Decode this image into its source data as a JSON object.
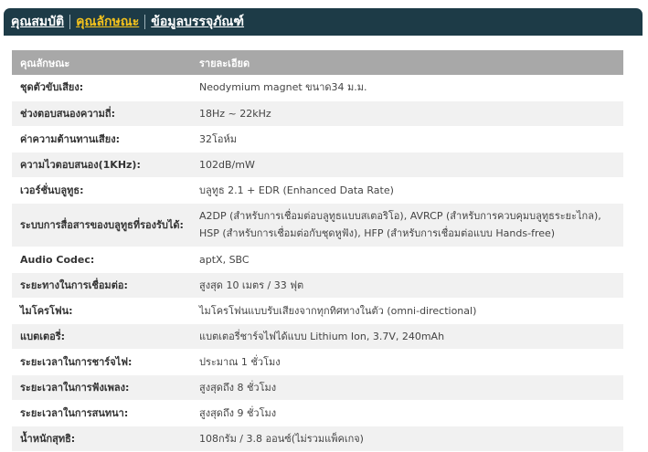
{
  "tabs": [
    {
      "label": "คุณสมบัติ",
      "active": false
    },
    {
      "label": "คุณลักษณะ",
      "active": true
    },
    {
      "label": "ข้อมูลบรรจุภัณฑ์",
      "active": false
    }
  ],
  "spec_table": {
    "headers": [
      "คุณลักษณะ",
      "รายละเอียด"
    ],
    "rows": [
      {
        "key": "ชุดตัวขับเสียง:",
        "value": "Neodymium magnet ขนาด34 ม.ม."
      },
      {
        "key": "ช่วงตอบสนองความถี่:",
        "value": "18Hz ~ 22kHz"
      },
      {
        "key": "ค่าความต้านทานเสียง:",
        "value": "32โอห์ม"
      },
      {
        "key": "ความไวตอบสนอง(1KHz):",
        "value": "102dB/mW"
      },
      {
        "key": "เวอร์ชั่นบลูทูธ:",
        "value": "บลูทูธ 2.1 + EDR (Enhanced Data Rate)"
      },
      {
        "key": "ระบบการสื่อสารของบลูทูธที่รองรับได้:",
        "value": "A2DP (สำหรับการเชื่อมต่อบลูทูธแบบสเตอริโอ), AVRCP (สำหรับการควบคุมบลูทูธระยะไกล), HSP (สำหรับการเชื่อมต่อกับชุดหูฟัง), HFP (สำหรับการเชื่อมต่อแบบ Hands-free)"
      },
      {
        "key": "Audio Codec:",
        "value": "aptX, SBC"
      },
      {
        "key": "ระยะทางในการเชื่อมต่อ:",
        "value": "สูงสุด 10 เมตร / 33 ฟุต"
      },
      {
        "key": "ไมโครโฟน:",
        "value": "ไมโครโฟนแบบรับเสียงจากทุกทิศทางในตัว (omni-directional)"
      },
      {
        "key": "แบตเตอรี่:",
        "value": "แบตเตอรี่ชาร์จไฟได้แบบ Lithium Ion, 3.7V, 240mAh"
      },
      {
        "key": "ระยะเวลาในการชาร์จไฟ:",
        "value": "ประมาณ 1 ชั่วโมง"
      },
      {
        "key": "ระยะเวลาในการฟังเพลง:",
        "value": "สูงสุดถึง 8 ชั่วโมง"
      },
      {
        "key": "ระยะเวลาในการสนทนา:",
        "value": "สูงสุดถึง 9 ชั่วโมง"
      },
      {
        "key": "น้ำหนักสุทธิ:",
        "value": "108กรัม / 3.8 ออนซ์(ไม่รวมแพ็คเกจ)"
      }
    ]
  },
  "colors": {
    "tabbar_bg": "#1d3b47",
    "active_tab": "#f3c21d",
    "header_bg": "#a8a8a8",
    "row_alt": "#f1f1f1"
  }
}
